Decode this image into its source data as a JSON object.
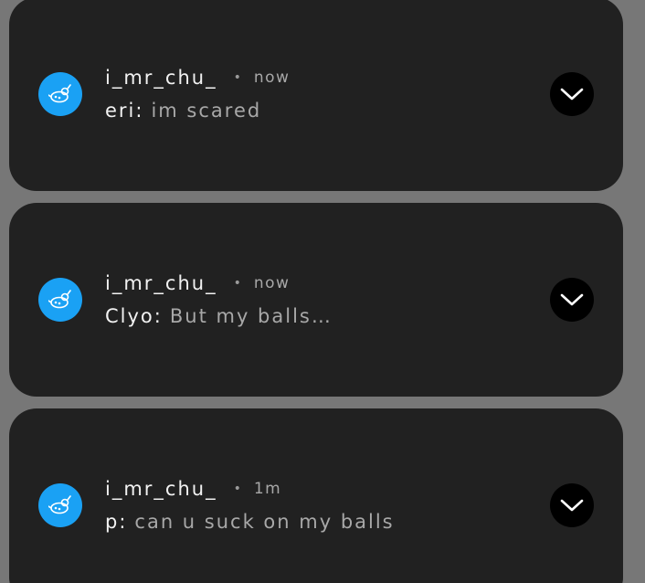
{
  "colors": {
    "background": "#777777",
    "card": "#212121",
    "app_icon_bg": "#1aa1f4",
    "expand_button_bg": "#000000"
  },
  "notifications": [
    {
      "app_icon": "bird-chat-app-icon",
      "sender": "i_mr_chu_",
      "separator": "•",
      "time": "now",
      "author": "eri:",
      "message": "im scared",
      "expand_icon": "chevron-down-icon"
    },
    {
      "app_icon": "bird-chat-app-icon",
      "sender": "i_mr_chu_",
      "separator": "•",
      "time": "now",
      "author": "Clyo:",
      "message": "But my balls…",
      "expand_icon": "chevron-down-icon"
    },
    {
      "app_icon": "bird-chat-app-icon",
      "sender": "i_mr_chu_",
      "separator": "•",
      "time": "1m",
      "author": "p:",
      "message": "can u suck on my balls",
      "expand_icon": "chevron-down-icon"
    }
  ]
}
